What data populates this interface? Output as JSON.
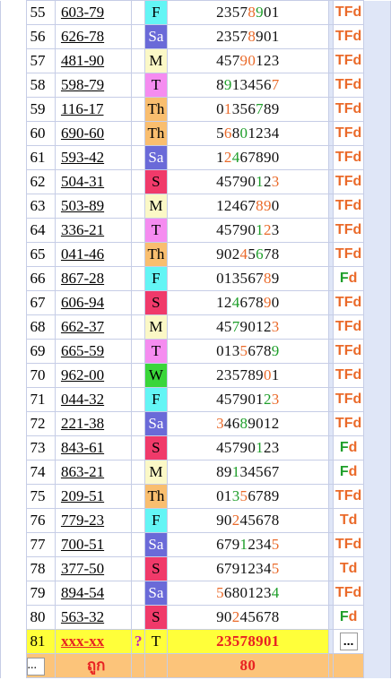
{
  "rows": [
    {
      "no": "55",
      "code": "603-79",
      "day": "F",
      "digits": [
        [
          "2",
          "k"
        ],
        [
          "3",
          "k"
        ],
        [
          "5",
          "k"
        ],
        [
          "7",
          "k"
        ],
        [
          "8",
          "r"
        ],
        [
          "9",
          "g"
        ],
        [
          "0",
          "k"
        ],
        [
          "1",
          "k"
        ]
      ],
      "res": [
        [
          "T",
          "r"
        ],
        [
          "F",
          "r"
        ],
        [
          "d",
          "r"
        ]
      ]
    },
    {
      "no": "56",
      "code": "626-78",
      "day": "Sa",
      "digits": [
        [
          "2",
          "k"
        ],
        [
          "3",
          "k"
        ],
        [
          "5",
          "k"
        ],
        [
          "7",
          "k"
        ],
        [
          "8",
          "r"
        ],
        [
          "9",
          "k"
        ],
        [
          "0",
          "k"
        ],
        [
          "1",
          "k"
        ]
      ],
      "res": [
        [
          "T",
          "r"
        ],
        [
          "F",
          "r"
        ],
        [
          "d",
          "r"
        ]
      ]
    },
    {
      "no": "57",
      "code": "481-90",
      "day": "M",
      "digits": [
        [
          "4",
          "k"
        ],
        [
          "5",
          "k"
        ],
        [
          "7",
          "k"
        ],
        [
          "9",
          "r"
        ],
        [
          "0",
          "r"
        ],
        [
          "1",
          "k"
        ],
        [
          "2",
          "k"
        ],
        [
          "3",
          "k"
        ]
      ],
      "res": [
        [
          "T",
          "r"
        ],
        [
          "F",
          "r"
        ],
        [
          "d",
          "r"
        ]
      ]
    },
    {
      "no": "58",
      "code": "598-79",
      "day": "T",
      "digits": [
        [
          "8",
          "k"
        ],
        [
          "9",
          "g"
        ],
        [
          "1",
          "k"
        ],
        [
          "3",
          "k"
        ],
        [
          "4",
          "k"
        ],
        [
          "5",
          "k"
        ],
        [
          "6",
          "k"
        ],
        [
          "7",
          "r"
        ]
      ],
      "res": [
        [
          "T",
          "r"
        ],
        [
          "F",
          "r"
        ],
        [
          "d",
          "r"
        ]
      ]
    },
    {
      "no": "59",
      "code": "116-17",
      "day": "Th",
      "digits": [
        [
          "0",
          "k"
        ],
        [
          "1",
          "r"
        ],
        [
          "3",
          "k"
        ],
        [
          "5",
          "k"
        ],
        [
          "6",
          "k"
        ],
        [
          "7",
          "g"
        ],
        [
          "8",
          "k"
        ],
        [
          "9",
          "k"
        ]
      ],
      "res": [
        [
          "T",
          "r"
        ],
        [
          "F",
          "r"
        ],
        [
          "d",
          "r"
        ]
      ]
    },
    {
      "no": "60",
      "code": "690-60",
      "day": "Th",
      "digits": [
        [
          "5",
          "k"
        ],
        [
          "6",
          "r"
        ],
        [
          "8",
          "k"
        ],
        [
          "0",
          "g"
        ],
        [
          "1",
          "k"
        ],
        [
          "2",
          "k"
        ],
        [
          "3",
          "k"
        ],
        [
          "4",
          "k"
        ]
      ],
      "res": [
        [
          "T",
          "r"
        ],
        [
          "F",
          "r"
        ],
        [
          "d",
          "r"
        ]
      ]
    },
    {
      "no": "61",
      "code": "593-42",
      "day": "Sa",
      "digits": [
        [
          "1",
          "k"
        ],
        [
          "2",
          "r"
        ],
        [
          "4",
          "g"
        ],
        [
          "6",
          "k"
        ],
        [
          "7",
          "k"
        ],
        [
          "8",
          "k"
        ],
        [
          "9",
          "k"
        ],
        [
          "0",
          "k"
        ]
      ],
      "res": [
        [
          "T",
          "r"
        ],
        [
          "F",
          "r"
        ],
        [
          "d",
          "r"
        ]
      ]
    },
    {
      "no": "62",
      "code": "504-31",
      "day": "S",
      "digits": [
        [
          "4",
          "k"
        ],
        [
          "5",
          "k"
        ],
        [
          "7",
          "k"
        ],
        [
          "9",
          "k"
        ],
        [
          "0",
          "k"
        ],
        [
          "1",
          "g"
        ],
        [
          "2",
          "k"
        ],
        [
          "3",
          "r"
        ]
      ],
      "res": [
        [
          "T",
          "r"
        ],
        [
          "F",
          "r"
        ],
        [
          "d",
          "r"
        ]
      ]
    },
    {
      "no": "63",
      "code": "503-89",
      "day": "M",
      "digits": [
        [
          "1",
          "k"
        ],
        [
          "2",
          "k"
        ],
        [
          "4",
          "k"
        ],
        [
          "6",
          "k"
        ],
        [
          "7",
          "k"
        ],
        [
          "8",
          "r"
        ],
        [
          "9",
          "r"
        ],
        [
          "0",
          "k"
        ]
      ],
      "res": [
        [
          "T",
          "r"
        ],
        [
          "F",
          "r"
        ],
        [
          "d",
          "r"
        ]
      ]
    },
    {
      "no": "64",
      "code": "336-21",
      "day": "T",
      "digits": [
        [
          "4",
          "k"
        ],
        [
          "5",
          "k"
        ],
        [
          "7",
          "k"
        ],
        [
          "9",
          "k"
        ],
        [
          "0",
          "k"
        ],
        [
          "1",
          "g"
        ],
        [
          "2",
          "r"
        ],
        [
          "3",
          "k"
        ]
      ],
      "res": [
        [
          "T",
          "r"
        ],
        [
          "F",
          "r"
        ],
        [
          "d",
          "r"
        ]
      ]
    },
    {
      "no": "65",
      "code": "041-46",
      "day": "Th",
      "digits": [
        [
          "9",
          "k"
        ],
        [
          "0",
          "k"
        ],
        [
          "2",
          "k"
        ],
        [
          "4",
          "r"
        ],
        [
          "5",
          "k"
        ],
        [
          "6",
          "g"
        ],
        [
          "7",
          "k"
        ],
        [
          "8",
          "k"
        ]
      ],
      "res": [
        [
          "T",
          "r"
        ],
        [
          "F",
          "r"
        ],
        [
          "d",
          "r"
        ]
      ]
    },
    {
      "no": "66",
      "code": "867-28",
      "day": "F",
      "digits": [
        [
          "0",
          "k"
        ],
        [
          "1",
          "k"
        ],
        [
          "3",
          "k"
        ],
        [
          "5",
          "k"
        ],
        [
          "6",
          "k"
        ],
        [
          "7",
          "k"
        ],
        [
          "8",
          "r"
        ],
        [
          "9",
          "k"
        ]
      ],
      "res": [
        [
          "F",
          "g"
        ],
        [
          "d",
          "r"
        ]
      ]
    },
    {
      "no": "67",
      "code": "606-94",
      "day": "S",
      "digits": [
        [
          "1",
          "k"
        ],
        [
          "2",
          "k"
        ],
        [
          "4",
          "g"
        ],
        [
          "6",
          "k"
        ],
        [
          "7",
          "k"
        ],
        [
          "8",
          "k"
        ],
        [
          "9",
          "r"
        ],
        [
          "0",
          "k"
        ]
      ],
      "res": [
        [
          "T",
          "r"
        ],
        [
          "F",
          "r"
        ],
        [
          "d",
          "r"
        ]
      ]
    },
    {
      "no": "68",
      "code": "662-37",
      "day": "M",
      "digits": [
        [
          "4",
          "k"
        ],
        [
          "5",
          "k"
        ],
        [
          "7",
          "g"
        ],
        [
          "9",
          "k"
        ],
        [
          "0",
          "k"
        ],
        [
          "1",
          "k"
        ],
        [
          "2",
          "k"
        ],
        [
          "3",
          "r"
        ]
      ],
      "res": [
        [
          "T",
          "r"
        ],
        [
          "F",
          "r"
        ],
        [
          "d",
          "r"
        ]
      ]
    },
    {
      "no": "69",
      "code": "665-59",
      "day": "T",
      "digits": [
        [
          "0",
          "k"
        ],
        [
          "1",
          "k"
        ],
        [
          "3",
          "k"
        ],
        [
          "5",
          "r"
        ],
        [
          "6",
          "k"
        ],
        [
          "7",
          "k"
        ],
        [
          "8",
          "k"
        ],
        [
          "9",
          "g"
        ]
      ],
      "res": [
        [
          "T",
          "r"
        ],
        [
          "F",
          "r"
        ],
        [
          "d",
          "r"
        ]
      ]
    },
    {
      "no": "70",
      "code": "962-00",
      "day": "W",
      "digits": [
        [
          "2",
          "k"
        ],
        [
          "3",
          "k"
        ],
        [
          "5",
          "k"
        ],
        [
          "7",
          "k"
        ],
        [
          "8",
          "k"
        ],
        [
          "9",
          "k"
        ],
        [
          "0",
          "r"
        ],
        [
          "1",
          "k"
        ]
      ],
      "res": [
        [
          "T",
          "r"
        ],
        [
          "F",
          "r"
        ],
        [
          "d",
          "r"
        ]
      ]
    },
    {
      "no": "71",
      "code": "044-32",
      "day": "F",
      "digits": [
        [
          "4",
          "k"
        ],
        [
          "5",
          "k"
        ],
        [
          "7",
          "k"
        ],
        [
          "9",
          "k"
        ],
        [
          "0",
          "k"
        ],
        [
          "1",
          "k"
        ],
        [
          "2",
          "g"
        ],
        [
          "3",
          "r"
        ]
      ],
      "res": [
        [
          "T",
          "r"
        ],
        [
          "F",
          "r"
        ],
        [
          "d",
          "r"
        ]
      ]
    },
    {
      "no": "72",
      "code": "221-38",
      "day": "Sa",
      "digits": [
        [
          "3",
          "r"
        ],
        [
          "4",
          "k"
        ],
        [
          "6",
          "k"
        ],
        [
          "8",
          "g"
        ],
        [
          "9",
          "k"
        ],
        [
          "0",
          "k"
        ],
        [
          "1",
          "k"
        ],
        [
          "2",
          "k"
        ]
      ],
      "res": [
        [
          "T",
          "r"
        ],
        [
          "F",
          "r"
        ],
        [
          "d",
          "r"
        ]
      ]
    },
    {
      "no": "73",
      "code": "843-61",
      "day": "S",
      "digits": [
        [
          "4",
          "k"
        ],
        [
          "5",
          "k"
        ],
        [
          "7",
          "k"
        ],
        [
          "9",
          "k"
        ],
        [
          "0",
          "k"
        ],
        [
          "1",
          "g"
        ],
        [
          "2",
          "k"
        ],
        [
          "3",
          "k"
        ]
      ],
      "res": [
        [
          "F",
          "g"
        ],
        [
          "d",
          "r"
        ]
      ]
    },
    {
      "no": "74",
      "code": "863-21",
      "day": "M",
      "digits": [
        [
          "8",
          "k"
        ],
        [
          "9",
          "k"
        ],
        [
          "1",
          "g"
        ],
        [
          "3",
          "k"
        ],
        [
          "4",
          "k"
        ],
        [
          "5",
          "k"
        ],
        [
          "6",
          "k"
        ],
        [
          "7",
          "k"
        ]
      ],
      "res": [
        [
          "F",
          "g"
        ],
        [
          "d",
          "r"
        ]
      ]
    },
    {
      "no": "75",
      "code": "209-51",
      "day": "Th",
      "digits": [
        [
          "0",
          "k"
        ],
        [
          "1",
          "k"
        ],
        [
          "3",
          "g"
        ],
        [
          "5",
          "r"
        ],
        [
          "6",
          "k"
        ],
        [
          "7",
          "k"
        ],
        [
          "8",
          "k"
        ],
        [
          "9",
          "k"
        ]
      ],
      "res": [
        [
          "T",
          "r"
        ],
        [
          "F",
          "r"
        ],
        [
          "d",
          "r"
        ]
      ]
    },
    {
      "no": "76",
      "code": "779-23",
      "day": "F",
      "digits": [
        [
          "9",
          "k"
        ],
        [
          "0",
          "k"
        ],
        [
          "2",
          "r"
        ],
        [
          "4",
          "k"
        ],
        [
          "5",
          "k"
        ],
        [
          "6",
          "k"
        ],
        [
          "7",
          "k"
        ],
        [
          "8",
          "k"
        ]
      ],
      "res": [
        [
          "T",
          "r"
        ],
        [
          "d",
          "r"
        ]
      ]
    },
    {
      "no": "77",
      "code": "700-51",
      "day": "Sa",
      "digits": [
        [
          "6",
          "k"
        ],
        [
          "7",
          "k"
        ],
        [
          "9",
          "k"
        ],
        [
          "1",
          "g"
        ],
        [
          "2",
          "k"
        ],
        [
          "3",
          "k"
        ],
        [
          "4",
          "k"
        ],
        [
          "5",
          "r"
        ]
      ],
      "res": [
        [
          "T",
          "r"
        ],
        [
          "F",
          "r"
        ],
        [
          "d",
          "r"
        ]
      ]
    },
    {
      "no": "78",
      "code": "377-50",
      "day": "S",
      "digits": [
        [
          "6",
          "k"
        ],
        [
          "7",
          "k"
        ],
        [
          "9",
          "k"
        ],
        [
          "1",
          "k"
        ],
        [
          "2",
          "k"
        ],
        [
          "3",
          "k"
        ],
        [
          "4",
          "k"
        ],
        [
          "5",
          "r"
        ]
      ],
      "res": [
        [
          "T",
          "r"
        ],
        [
          "d",
          "r"
        ]
      ]
    },
    {
      "no": "79",
      "code": "894-54",
      "day": "Sa",
      "digits": [
        [
          "5",
          "r"
        ],
        [
          "6",
          "k"
        ],
        [
          "8",
          "k"
        ],
        [
          "0",
          "k"
        ],
        [
          "1",
          "k"
        ],
        [
          "2",
          "k"
        ],
        [
          "3",
          "k"
        ],
        [
          "4",
          "g"
        ]
      ],
      "res": [
        [
          "T",
          "r"
        ],
        [
          "F",
          "r"
        ],
        [
          "d",
          "r"
        ]
      ]
    },
    {
      "no": "80",
      "code": "563-32",
      "day": "S",
      "digits": [
        [
          "9",
          "k"
        ],
        [
          "0",
          "k"
        ],
        [
          "2",
          "r"
        ],
        [
          "4",
          "k"
        ],
        [
          "5",
          "k"
        ],
        [
          "6",
          "k"
        ],
        [
          "7",
          "k"
        ],
        [
          "8",
          "k"
        ]
      ],
      "res": [
        [
          "F",
          "g"
        ],
        [
          "d",
          "r"
        ]
      ]
    }
  ],
  "highlight_row": {
    "no": "81",
    "code": "xxx-xx",
    "q": "?",
    "day": "T",
    "digits": "23578901",
    "res": "..."
  },
  "summary_row": {
    "left": "...",
    "label": "ถูก",
    "value": "80"
  },
  "colors": {
    "red": "#ea6a2a",
    "green": "#1e9e2a",
    "highlight": "#ffff3a",
    "summary": "#fcc47a"
  }
}
